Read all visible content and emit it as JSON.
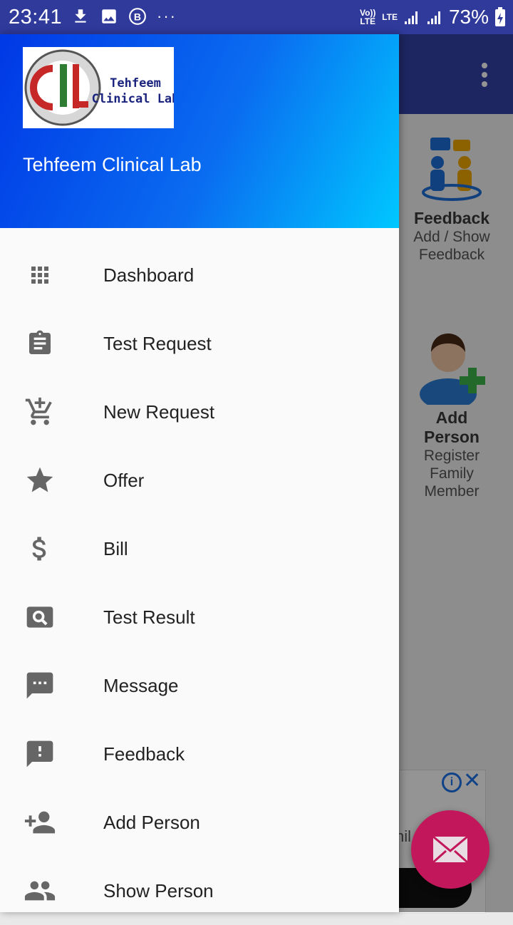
{
  "status_bar": {
    "time": "23:41",
    "network_volte": "Vo)) LTE",
    "network_lte": "LTE",
    "battery": "73%"
  },
  "drawer": {
    "title": "Tehfeem Clinical Lab",
    "logo_text_line1": "Tehfeem",
    "logo_text_line2": "Clinical Lab",
    "items": [
      {
        "label": "Dashboard",
        "icon": "apps-grid-icon"
      },
      {
        "label": "Test Request",
        "icon": "clipboard-icon"
      },
      {
        "label": "New Request",
        "icon": "add-cart-icon"
      },
      {
        "label": "Offer",
        "icon": "star-icon"
      },
      {
        "label": "Bill",
        "icon": "dollar-icon"
      },
      {
        "label": "Test Result",
        "icon": "search-image-icon"
      },
      {
        "label": "Message",
        "icon": "message-icon"
      },
      {
        "label": "Feedback",
        "icon": "feedback-icon"
      },
      {
        "label": "Add Person",
        "icon": "person-add-icon"
      },
      {
        "label": "Show Person",
        "icon": "people-icon"
      }
    ]
  },
  "background": {
    "cards": [
      {
        "title": "Feedback",
        "subtitle": "Add / Show Feedback"
      },
      {
        "title": "Add Person",
        "subtitle": "Register Family Member"
      }
    ],
    "ad_partial_text": "nil"
  },
  "colors": {
    "status_bar": "#2f3a9b",
    "header_gradient_start": "#0038e6",
    "header_gradient_end": "#00c8ff",
    "fab": "#c2185b",
    "icon_gray": "#666666"
  }
}
